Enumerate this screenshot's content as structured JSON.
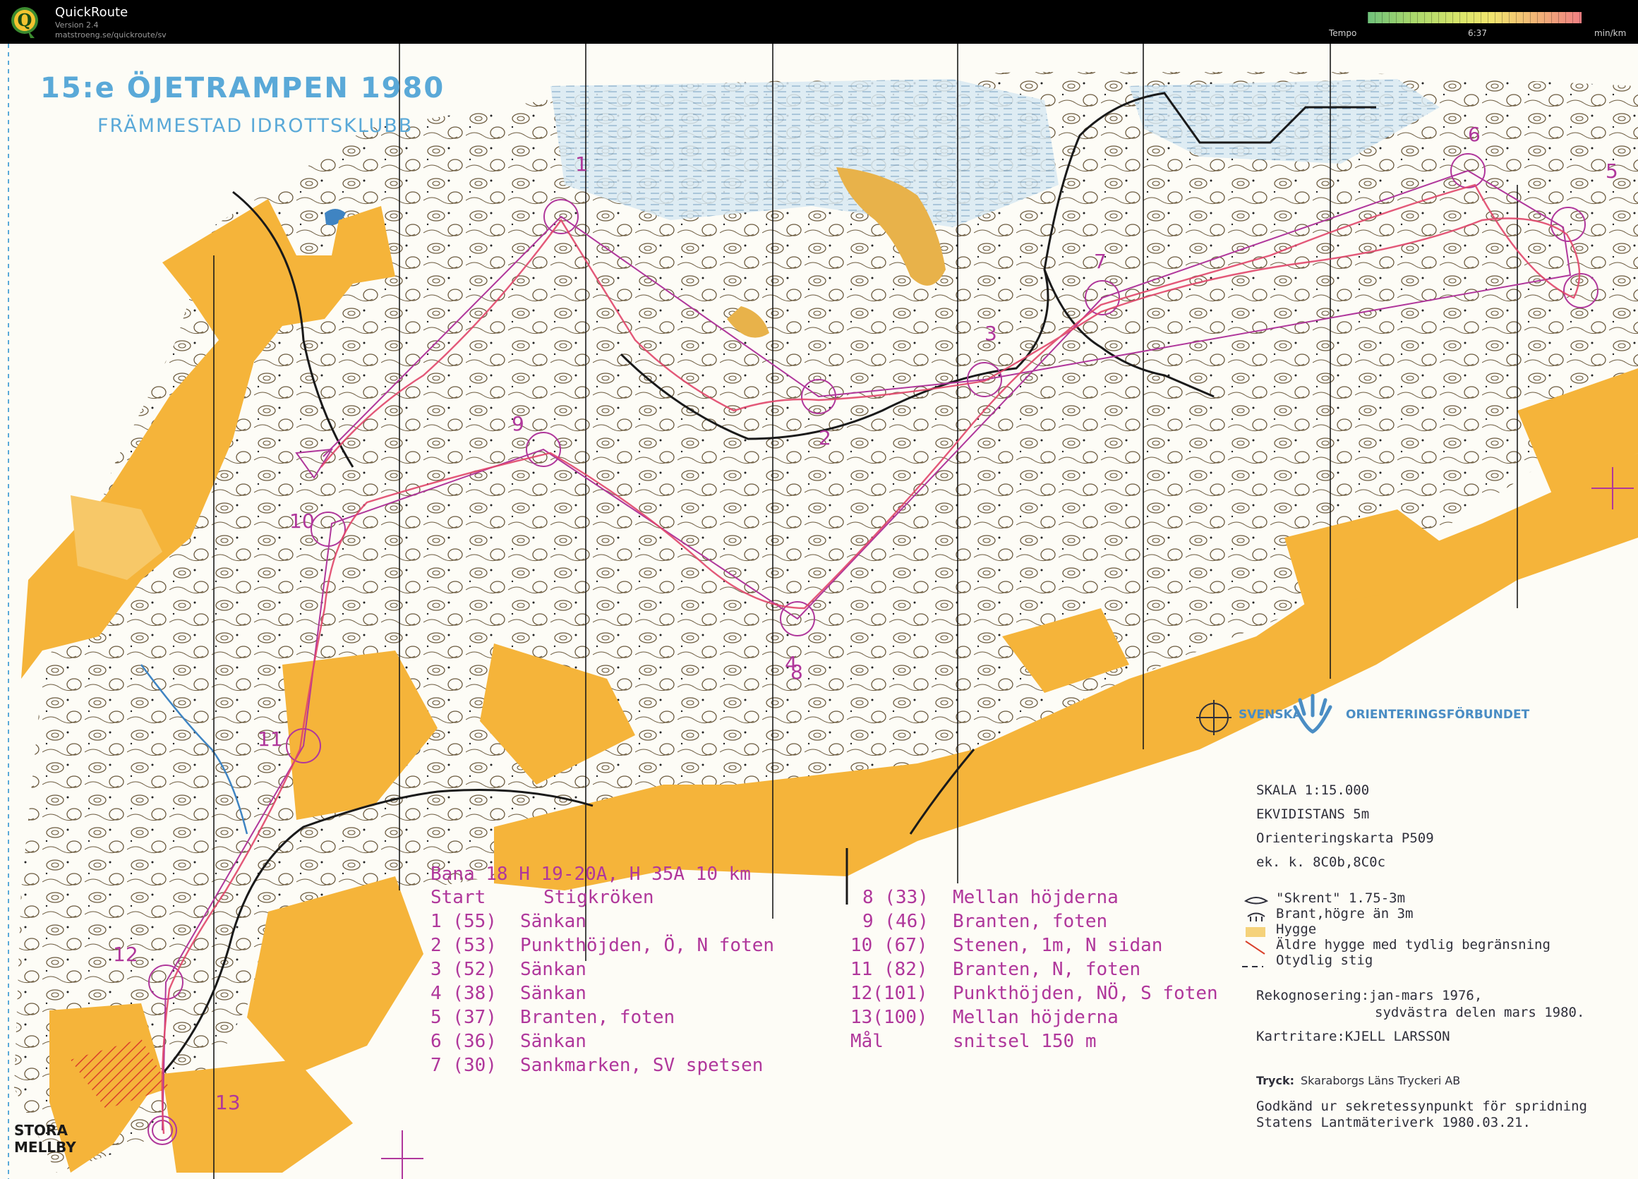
{
  "app": {
    "name": "QuickRoute",
    "version": "Version 2.4",
    "url": "matstroeng.se/quickroute/sv",
    "logo_letter": "Q"
  },
  "tempo": {
    "label": "Tempo",
    "value": "6:37",
    "unit": "min/km"
  },
  "map": {
    "title": "15:e ÖJETRAMPEN 1980",
    "club": "FRÄMMESTAD IDROTTSKLUBB",
    "place": [
      "STORA",
      "MELLBY"
    ],
    "control_numbers": [
      "1",
      "2",
      "3",
      "4",
      "5",
      "6",
      "7",
      "8",
      "9",
      "10",
      "11",
      "12",
      "13"
    ],
    "course": {
      "header": "Bana 18  H 19-20A, H 35A  10 km",
      "start": [
        "Start",
        "Stigkröken"
      ],
      "controls_left": [
        [
          "1 (55)",
          "Sänkan"
        ],
        [
          "2 (53)",
          "Punkthöjden, Ö, N foten"
        ],
        [
          "3 (52)",
          "Sänkan"
        ],
        [
          "4 (38)",
          "Sänkan"
        ],
        [
          "5 (37)",
          "Branten, foten"
        ],
        [
          "6 (36)",
          "Sänkan"
        ],
        [
          "7 (30)",
          "Sankmarken, SV spetsen"
        ]
      ],
      "controls_right": [
        [
          "8 (33)",
          "Mellan höjderna"
        ],
        [
          "9 (46)",
          "Branten, foten"
        ],
        [
          "10 (67)",
          "Stenen, 1m, N sidan"
        ],
        [
          "11 (82)",
          "Branten, N, foten"
        ],
        [
          "12(101)",
          "Punkthöjden, NÖ, S foten"
        ],
        [
          "13(100)",
          "Mellan höjderna"
        ]
      ],
      "finish": [
        "Mål",
        "snitsel 150 m"
      ]
    },
    "federation": [
      "SVENSKA",
      "ORIENTERINGSFÖRBUNDET"
    ],
    "info": {
      "scale": "SKALA   1:15.000",
      "equidistance": "EKVIDISTANS  5m",
      "map_no": "Orienteringskarta P509",
      "ek": "ek. k. 8C0b,8C0c",
      "legend": [
        "\"Skrent\" 1.75-3m",
        "Brant,högre än 3m",
        "Hygge",
        "Äldre hygge med tydlig begränsning",
        "Otydlig stig"
      ],
      "recon_1": "Rekognosering:jan-mars 1976,",
      "recon_2": "sydvästra delen mars 1980.",
      "cartographer": "Kartritare:KJELL LARSSON",
      "print_label": "Tryck:",
      "print_value": "Skaraborgs Läns Tryckeri AB",
      "approval_1": "Godkänd ur sekretessynpunkt för spridning",
      "approval_2": "Statens Lantmäteriverk 1980.03.21."
    },
    "colors": {
      "open_land": "#f5b43a",
      "water_marsh": "#cfe3ef",
      "course_print": "#b0379b",
      "route": "#e0466a",
      "title_blue": "#5aa9d8"
    }
  }
}
